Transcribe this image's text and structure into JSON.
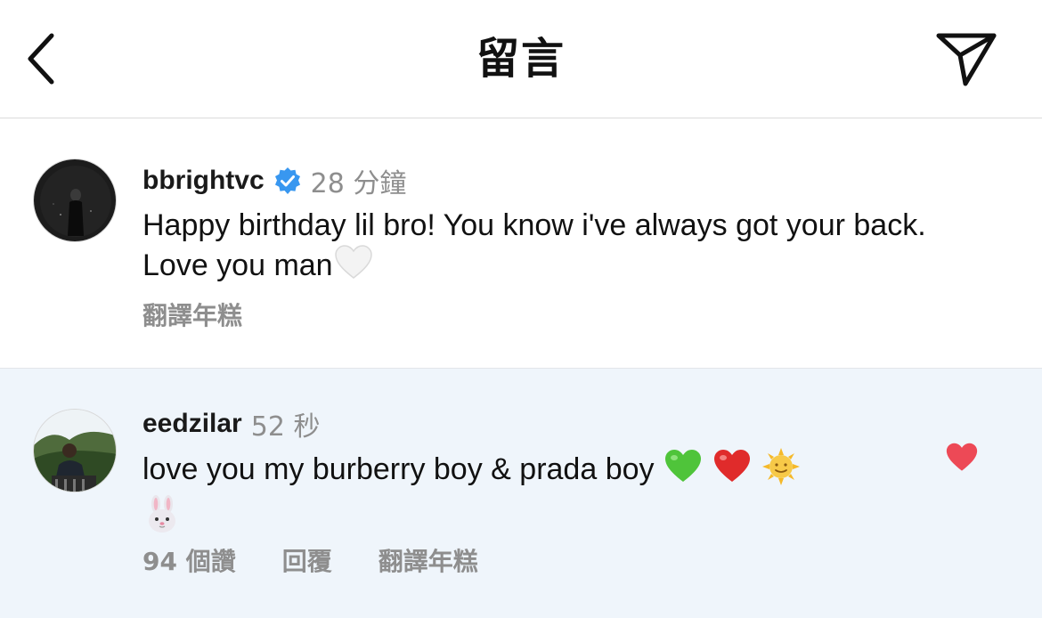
{
  "header": {
    "title": "留言",
    "back_icon": "chevron-left-icon",
    "share_icon": "paper-plane-icon"
  },
  "comments": [
    {
      "username": "bbrightvc",
      "verified": true,
      "time": "28 分鐘",
      "text": "Happy birthday lil bro! You know i've always got your back. Love you man",
      "emojis": [
        "white-heart"
      ],
      "actions": [
        "翻譯年糕"
      ]
    },
    {
      "username": "eedzilar",
      "verified": false,
      "time": "52 秒",
      "text": "love you my burberry boy & prada boy",
      "emojis": [
        "green-heart",
        "red-heart",
        "sun-with-face",
        "rabbit-face"
      ],
      "actions": [
        "94 個讚",
        "回覆",
        "翻譯年糕"
      ],
      "liked": true
    }
  ],
  "colors": {
    "verified_blue": "#3897f0",
    "like_red": "#ed4956",
    "secondary_text": "#8e8e8e",
    "highlight_bg": "#eff5fb"
  }
}
